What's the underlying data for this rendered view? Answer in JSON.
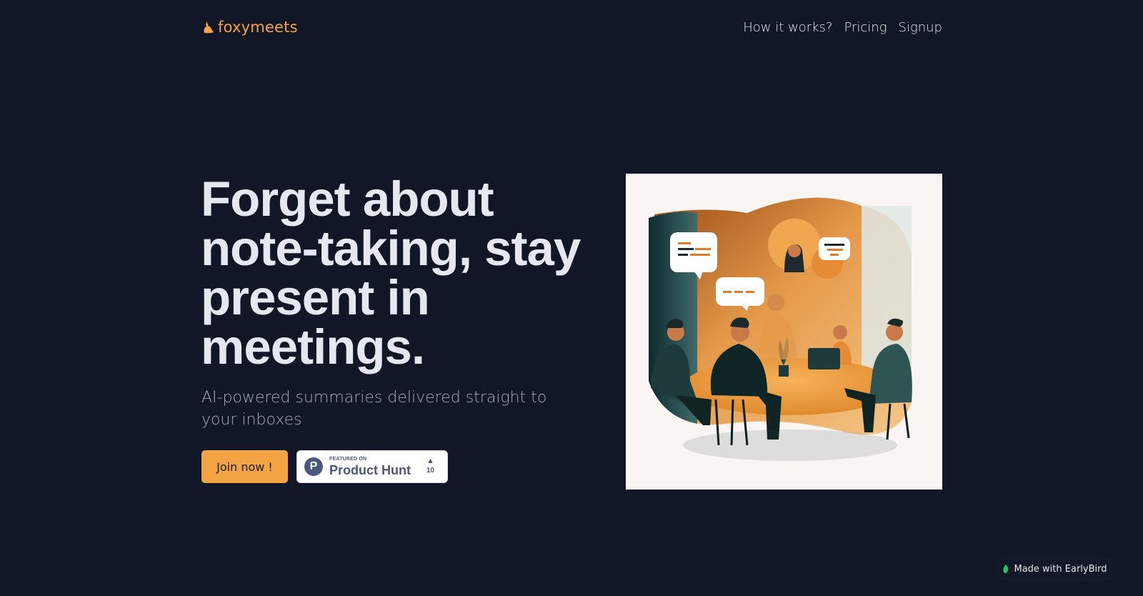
{
  "brand": {
    "name": "foxymeets",
    "accent": "#f2a442",
    "background": "#111727"
  },
  "nav": {
    "items": [
      {
        "label": "How it works?"
      },
      {
        "label": "Pricing"
      },
      {
        "label": "Signup"
      }
    ]
  },
  "hero": {
    "title": "Forget about note-taking, stay present in meetings.",
    "subtitle": "AI-powered summaries delivered straight to your inboxes",
    "join_label": "Join now !"
  },
  "product_hunt": {
    "featured_label": "FEATURED ON",
    "name": "Product Hunt",
    "upvote_icon": "triangle-up-icon",
    "votes": "10"
  },
  "illustration": {
    "subject": "meeting-illustration"
  },
  "footer": {
    "made_with": "Made with EarlyBird"
  }
}
